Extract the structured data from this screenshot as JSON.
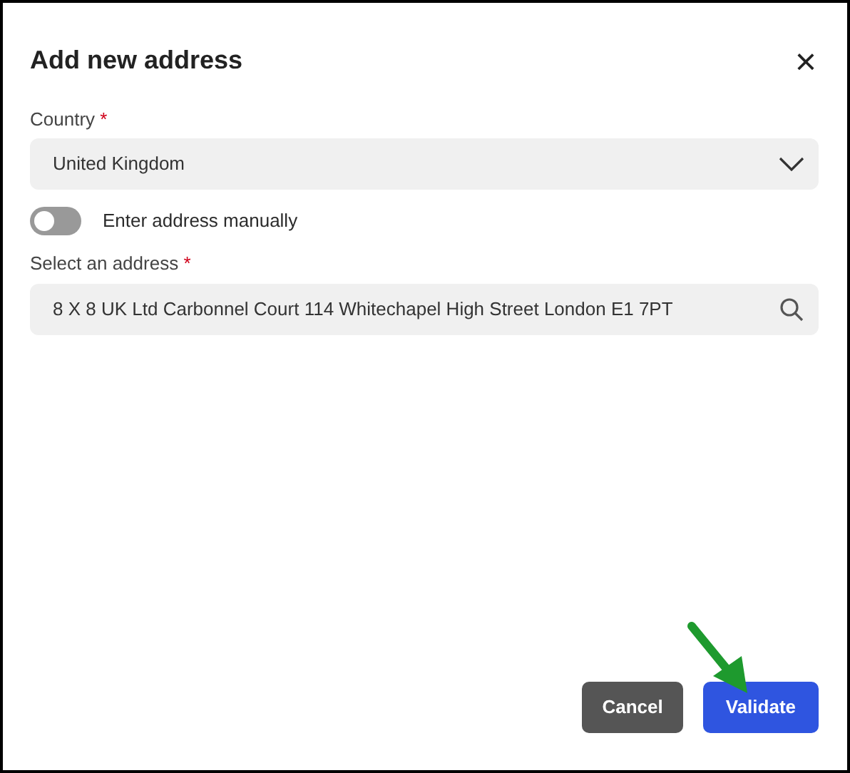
{
  "dialog": {
    "title": "Add new address",
    "close": "×"
  },
  "country": {
    "label": "Country",
    "required_mark": "*",
    "value": "United Kingdom"
  },
  "manual_toggle": {
    "label": "Enter address manually",
    "on": false
  },
  "address": {
    "label": "Select an address",
    "required_mark": "*",
    "value": "8 X 8 UK Ltd Carbonnel Court 114 Whitechapel High Street London E1 7PT"
  },
  "buttons": [
    {
      "label": "Cancel",
      "kind": "secondary"
    },
    {
      "label": "Validate",
      "kind": "primary"
    }
  ]
}
